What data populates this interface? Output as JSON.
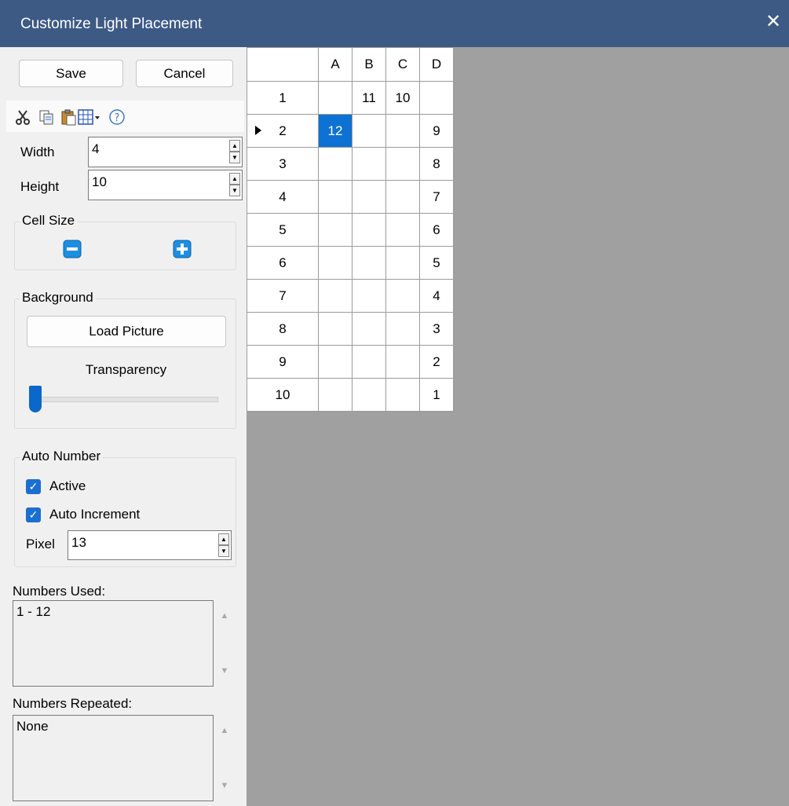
{
  "window": {
    "title": "Customize Light Placement",
    "close_glyph": "✕"
  },
  "buttons": {
    "save": "Save",
    "cancel": "Cancel",
    "load_picture": "Load Picture"
  },
  "toolbar": {
    "icons": [
      "cut-icon",
      "copy-icon",
      "paste-icon",
      "grid-dropdown-icon",
      "help-icon"
    ]
  },
  "size": {
    "width_label": "Width",
    "width_value": "4",
    "height_label": "Height",
    "height_value": "10"
  },
  "cell_size": {
    "label": "Cell Size"
  },
  "background": {
    "label": "Background",
    "transparency_label": "Transparency",
    "transparency_level": 0
  },
  "auto_number": {
    "label": "Auto Number",
    "active_label": "Active",
    "active_checked": true,
    "auto_increment_label": "Auto Increment",
    "auto_increment_checked": true,
    "pixel_label": "Pixel",
    "pixel_value": "13"
  },
  "numbers_used": {
    "label": "Numbers Used:",
    "value": "1 - 12"
  },
  "numbers_repeated": {
    "label": "Numbers Repeated:",
    "value": "None"
  },
  "grid": {
    "columns": [
      "A",
      "B",
      "C",
      "D"
    ],
    "rows": [
      {
        "label": "1",
        "cells": [
          "",
          "11",
          "10",
          ""
        ]
      },
      {
        "label": "2",
        "cells": [
          "12",
          "",
          "",
          "9"
        ]
      },
      {
        "label": "3",
        "cells": [
          "",
          "",
          "",
          "8"
        ]
      },
      {
        "label": "4",
        "cells": [
          "",
          "",
          "",
          "7"
        ]
      },
      {
        "label": "5",
        "cells": [
          "",
          "",
          "",
          "6"
        ]
      },
      {
        "label": "6",
        "cells": [
          "",
          "",
          "",
          "5"
        ]
      },
      {
        "label": "7",
        "cells": [
          "",
          "",
          "",
          "4"
        ]
      },
      {
        "label": "8",
        "cells": [
          "",
          "",
          "",
          "3"
        ]
      },
      {
        "label": "9",
        "cells": [
          "",
          "",
          "",
          "2"
        ]
      },
      {
        "label": "10",
        "cells": [
          "",
          "",
          "",
          "1"
        ]
      }
    ],
    "selected": {
      "row": 1,
      "col": 0
    },
    "current_row": 1
  },
  "colors": {
    "titlebar": "#3c5a84",
    "selection": "#0e72d4",
    "canvas_bg": "#a0a0a0"
  }
}
